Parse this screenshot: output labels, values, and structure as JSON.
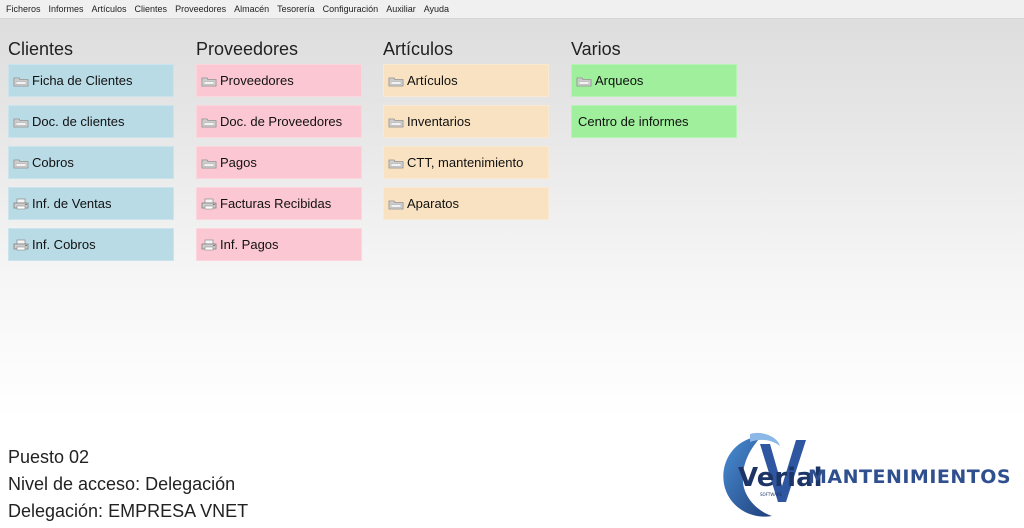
{
  "menu": [
    "Ficheros",
    "Informes",
    "Artículos",
    "Clientes",
    "Proveedores",
    "Almacén",
    "Tesorería",
    "Configuración",
    "Auxiliar",
    "Ayuda"
  ],
  "columns": {
    "clientes": {
      "title": "Clientes",
      "color": "#b8dbe6",
      "items": [
        {
          "label": "Ficha de Clientes",
          "icon": "folder-icon"
        },
        {
          "label": "Doc. de clientes",
          "icon": "folder-icon"
        },
        {
          "label": "Cobros",
          "icon": "folder-icon"
        },
        {
          "label": "Inf. de Ventas",
          "icon": "printer-icon"
        },
        {
          "label": "Inf. Cobros",
          "icon": "printer-icon"
        }
      ]
    },
    "proveedores": {
      "title": "Proveedores",
      "color": "#fbc7d2",
      "items": [
        {
          "label": "Proveedores",
          "icon": "folder-icon"
        },
        {
          "label": "Doc. de Proveedores",
          "icon": "folder-icon"
        },
        {
          "label": "Pagos",
          "icon": "folder-icon"
        },
        {
          "label": "Facturas Recibidas",
          "icon": "printer-icon"
        },
        {
          "label": "Inf. Pagos",
          "icon": "printer-icon"
        }
      ]
    },
    "articulos": {
      "title": "Artículos",
      "color": "#f9e2c2",
      "items": [
        {
          "label": "Artículos",
          "icon": "folder-icon"
        },
        {
          "label": "Inventarios",
          "icon": "folder-icon"
        },
        {
          "label": "CTT, mantenimiento",
          "icon": "folder-icon"
        },
        {
          "label": "Aparatos",
          "icon": "folder-icon"
        }
      ]
    },
    "varios": {
      "title": "Varios",
      "color": "#9fef9c",
      "items": [
        {
          "label": "Arqueos",
          "icon": "folder-icon"
        },
        {
          "label": "Centro de informes",
          "icon": ""
        }
      ]
    }
  },
  "status": {
    "puesto": "Puesto 02",
    "nivel": "Nivel de acceso: Delegación",
    "delegacion": "Delegación: EMPRESA VNET"
  },
  "logo": {
    "brand": "Verial",
    "product": "MANTENIMIENTOS",
    "tagline": "SOFTWARE"
  }
}
